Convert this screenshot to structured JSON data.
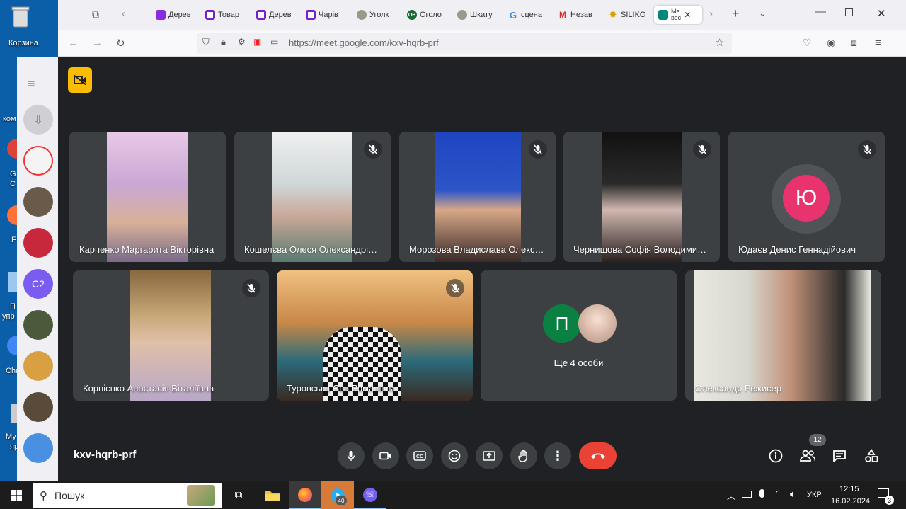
{
  "desktop": {
    "icons": [
      {
        "label": "Корзина"
      },
      {
        "label": "ком"
      },
      {
        "label": "G"
      },
      {
        "label": "C"
      },
      {
        "label": "F"
      },
      {
        "label": "П"
      },
      {
        "label": "упр"
      },
      {
        "label": "Chr"
      },
      {
        "label": "Му"
      },
      {
        "label": "ярлык"
      }
    ]
  },
  "browser": {
    "tabs": [
      {
        "label": "Дерев",
        "icon": "purple-bag-icon",
        "color": "#8a2be2"
      },
      {
        "label": "Товар",
        "icon": "purple-square-icon",
        "color": "#7a1fc7"
      },
      {
        "label": "Дерев",
        "icon": "purple-square-icon",
        "color": "#7a1fc7"
      },
      {
        "label": "Чарів",
        "icon": "purple-square-icon",
        "color": "#7a1fc7"
      },
      {
        "label": "Уголк",
        "icon": "globe-icon",
        "color": "#888"
      },
      {
        "label": "Оголо",
        "icon": "green-circle-icon",
        "color": "#2a7a3a"
      },
      {
        "label": "Шкату",
        "icon": "globe-icon",
        "color": "#888"
      },
      {
        "label": "сцена",
        "icon": "google-icon",
        "color": "#4285f4"
      },
      {
        "label": "Незав",
        "icon": "gmail-icon",
        "color": "#d93025"
      },
      {
        "label": "SILIKO",
        "icon": "star-icon",
        "color": "#d4a000"
      },
      {
        "label": "Me\nвос",
        "icon": "meet-icon",
        "color": "#00897b"
      }
    ],
    "url": "https://meet.google.com/kxv-hqrb-prf"
  },
  "sidebar": {
    "badge": "C2"
  },
  "meet": {
    "code": "kxv-hqrb-prf",
    "participants_count": "12",
    "tiles": [
      {
        "name": "Карпенко Маргарита Вікторівна",
        "muted": false,
        "bg": "#c9a8d4"
      },
      {
        "name": "Кошелєва Олеся Олександрівна",
        "muted": true,
        "bg": "#cfd7d8"
      },
      {
        "name": "Морозова Владислава Олександрівна",
        "muted": true,
        "bg": "#2d55c8"
      },
      {
        "name": "Чернишова Софія Володимирівна",
        "muted": true,
        "bg": "#3a3a3a"
      },
      {
        "name": "Юдаєв Денис Геннадійович",
        "muted": true,
        "avatar": "Ю",
        "avatar_color": "#e8336e"
      },
      {
        "name": "Корнієнко Анастасія Віталіївна",
        "muted": true,
        "bg": "#c8a878"
      },
      {
        "name": "Туровська Єва Романівна",
        "muted": true,
        "bg": "#c88848"
      },
      {
        "name": "Олександр Режисер",
        "muted": false,
        "bg": "#d8d8d0"
      }
    ],
    "others": {
      "label": "Ще 4 особи",
      "avatar": "П",
      "avatar_color": "#0b8043"
    }
  },
  "taskbar": {
    "search": "Пошук",
    "lang": "УКР",
    "time": "12:15",
    "date": "16.02.2024",
    "telegram_badge": "40",
    "notif_badge": "3"
  }
}
